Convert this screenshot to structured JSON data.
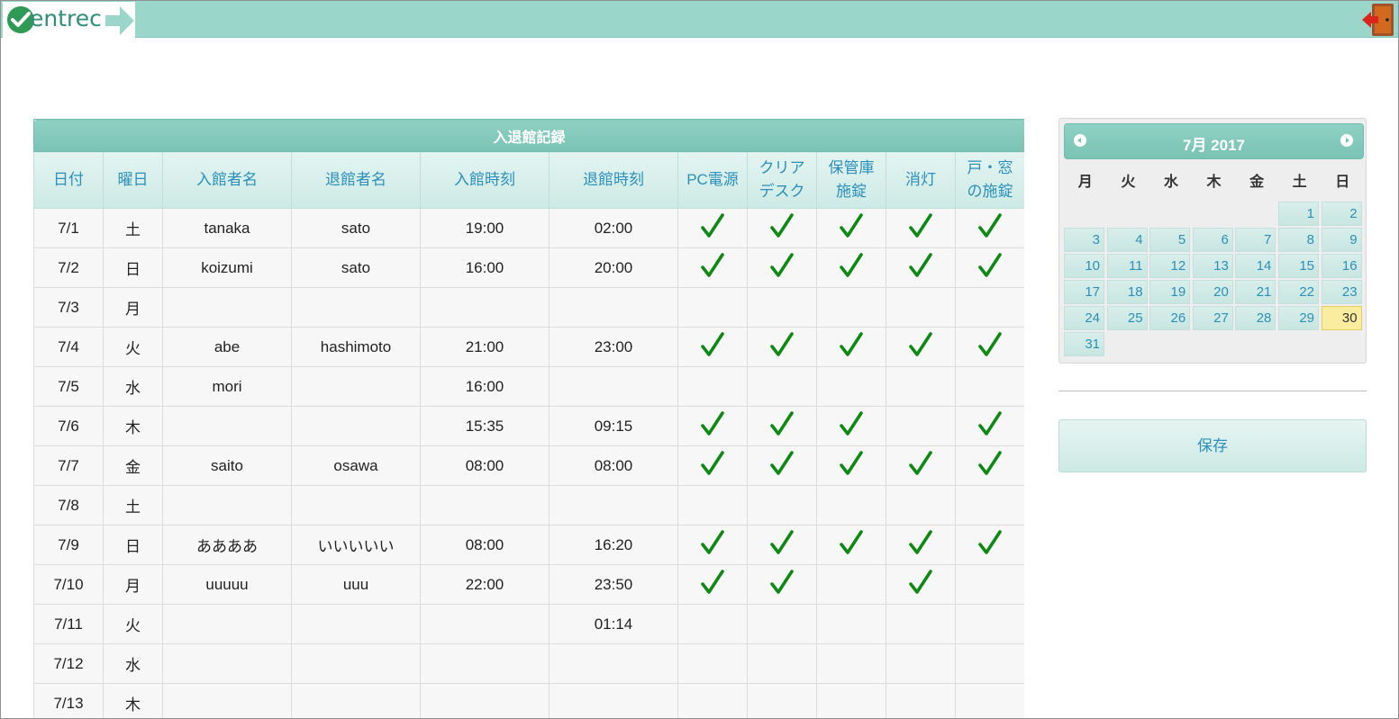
{
  "app": {
    "logo_text": "entrec"
  },
  "table": {
    "caption": "入退館記録",
    "headers": {
      "date": "日付",
      "weekday": "曜日",
      "entrant": "入館者名",
      "leaver": "退館者名",
      "in_time": "入館時刻",
      "out_time": "退館時刻",
      "pc": "PC電源",
      "clear_desk_1": "クリア",
      "clear_desk_2": "デスク",
      "storage_1": "保管庫",
      "storage_2": "施錠",
      "lights": "消灯",
      "doors_1": "戸・窓",
      "doors_2": "の施錠"
    },
    "rows": [
      {
        "date": "7/1",
        "weekday": "土",
        "entrant": "tanaka",
        "leaver": "sato",
        "in": "19:00",
        "out": "02:00",
        "checks": [
          true,
          true,
          true,
          true,
          true
        ]
      },
      {
        "date": "7/2",
        "weekday": "日",
        "entrant": "koizumi",
        "leaver": "sato",
        "in": "16:00",
        "out": "20:00",
        "checks": [
          true,
          true,
          true,
          true,
          true
        ]
      },
      {
        "date": "7/3",
        "weekday": "月",
        "entrant": "",
        "leaver": "",
        "in": "",
        "out": "",
        "checks": [
          false,
          false,
          false,
          false,
          false
        ]
      },
      {
        "date": "7/4",
        "weekday": "火",
        "entrant": "abe",
        "leaver": "hashimoto",
        "in": "21:00",
        "out": "23:00",
        "checks": [
          true,
          true,
          true,
          true,
          true
        ]
      },
      {
        "date": "7/5",
        "weekday": "水",
        "entrant": "mori",
        "leaver": "",
        "in": "16:00",
        "out": "",
        "checks": [
          false,
          false,
          false,
          false,
          false
        ]
      },
      {
        "date": "7/6",
        "weekday": "木",
        "entrant": "",
        "leaver": "",
        "in": "15:35",
        "out": "09:15",
        "checks": [
          true,
          true,
          true,
          false,
          true
        ]
      },
      {
        "date": "7/7",
        "weekday": "金",
        "entrant": "saito",
        "leaver": "osawa",
        "in": "08:00",
        "out": "08:00",
        "checks": [
          true,
          true,
          true,
          true,
          true
        ]
      },
      {
        "date": "7/8",
        "weekday": "土",
        "entrant": "",
        "leaver": "",
        "in": "",
        "out": "",
        "checks": [
          false,
          false,
          false,
          false,
          false
        ]
      },
      {
        "date": "7/9",
        "weekday": "日",
        "entrant": "ああああ",
        "leaver": "いいいいい",
        "in": "08:00",
        "out": "16:20",
        "checks": [
          true,
          true,
          true,
          true,
          true
        ]
      },
      {
        "date": "7/10",
        "weekday": "月",
        "entrant": "uuuuu",
        "leaver": "uuu",
        "in": "22:00",
        "out": "23:50",
        "checks": [
          true,
          true,
          false,
          true,
          false
        ]
      },
      {
        "date": "7/11",
        "weekday": "火",
        "entrant": "",
        "leaver": "",
        "in": "",
        "out": "01:14",
        "checks": [
          false,
          false,
          false,
          false,
          false
        ]
      },
      {
        "date": "7/12",
        "weekday": "水",
        "entrant": "",
        "leaver": "",
        "in": "",
        "out": "",
        "checks": [
          false,
          false,
          false,
          false,
          false
        ]
      },
      {
        "date": "7/13",
        "weekday": "木",
        "entrant": "",
        "leaver": "",
        "in": "",
        "out": "",
        "checks": [
          false,
          false,
          false,
          false,
          false
        ]
      }
    ]
  },
  "calendar": {
    "title": "7月 2017",
    "weekdays": [
      "月",
      "火",
      "水",
      "木",
      "金",
      "土",
      "日"
    ],
    "first_day_column": 5,
    "days_in_month": 31,
    "selected_day": 30
  },
  "actions": {
    "save_label": "保存"
  },
  "colors": {
    "header_bar": "#9bd6cb",
    "accent_text": "#2b8fb9",
    "check_green": "#0e8a14",
    "today_highlight": "#fbeda0"
  },
  "icons": {
    "logo_check": "check-circle-icon",
    "logo_arrow": "arrow-right-icon",
    "exit": "exit-door-icon",
    "check": "checkmark-icon",
    "prev": "chevron-left-icon",
    "next": "chevron-right-icon"
  }
}
